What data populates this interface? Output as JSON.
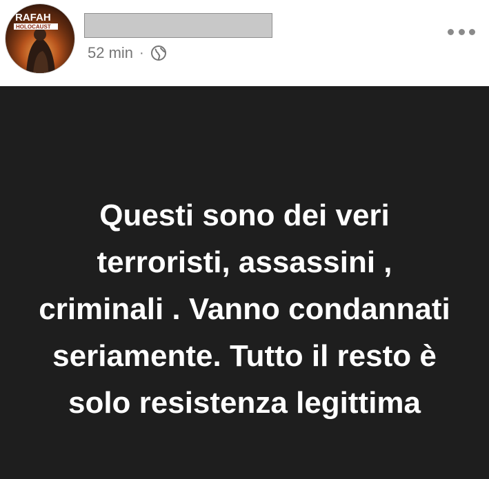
{
  "header": {
    "avatar_text_top": "RAFAH",
    "avatar_text_bottom": "HOLOCAUST",
    "timestamp": "52 min",
    "separator": "·",
    "privacy_icon": "globe-icon",
    "more_icon": "more-options-icon"
  },
  "post": {
    "background_color": "#1e1e1e",
    "text_color": "#ffffff",
    "lines": [
      "Questi sono dei veri",
      "terroristi, assassini ,",
      "criminali . Vanno condannati",
      "seriamente. Tutto il resto è",
      "solo resistenza legittima"
    ]
  }
}
